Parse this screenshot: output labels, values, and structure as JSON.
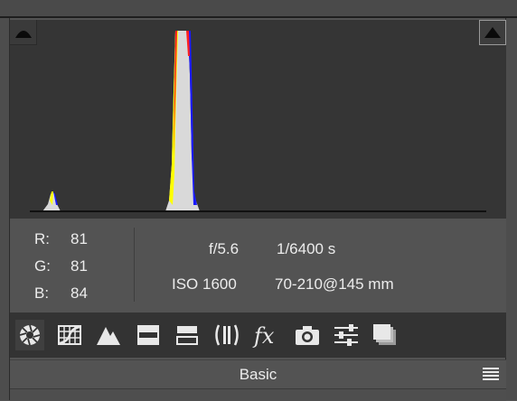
{
  "histogram": {
    "shadow_clip_icon": "shadow-clipping-warning-icon",
    "highlight_clip_icon": "highlight-clipping-warning-icon",
    "channel_colors": {
      "red": "#ff2020",
      "green": "#ffff00",
      "blue": "#1a1aff",
      "luminance": "#d9d9d9"
    }
  },
  "info": {
    "r_label": "R:",
    "r_value": "81",
    "g_label": "G:",
    "g_value": "81",
    "b_label": "B:",
    "b_value": "84",
    "aperture": "f/5.6",
    "shutter": "1/6400 s",
    "iso": "ISO 1600",
    "lens": "70-210@145 mm"
  },
  "toolbar": {
    "tools": [
      {
        "name": "basic-icon",
        "active": true
      },
      {
        "name": "tone-curve-icon"
      },
      {
        "name": "detail-icon"
      },
      {
        "name": "hsl-grayscale-icon"
      },
      {
        "name": "split-toning-icon"
      },
      {
        "name": "lens-corrections-icon"
      },
      {
        "name": "effects-icon"
      },
      {
        "name": "camera-calibration-icon"
      },
      {
        "name": "presets-icon"
      },
      {
        "name": "snapshots-icon"
      }
    ]
  },
  "section": {
    "title": "Basic",
    "menu_icon": "panel-menu-icon"
  }
}
